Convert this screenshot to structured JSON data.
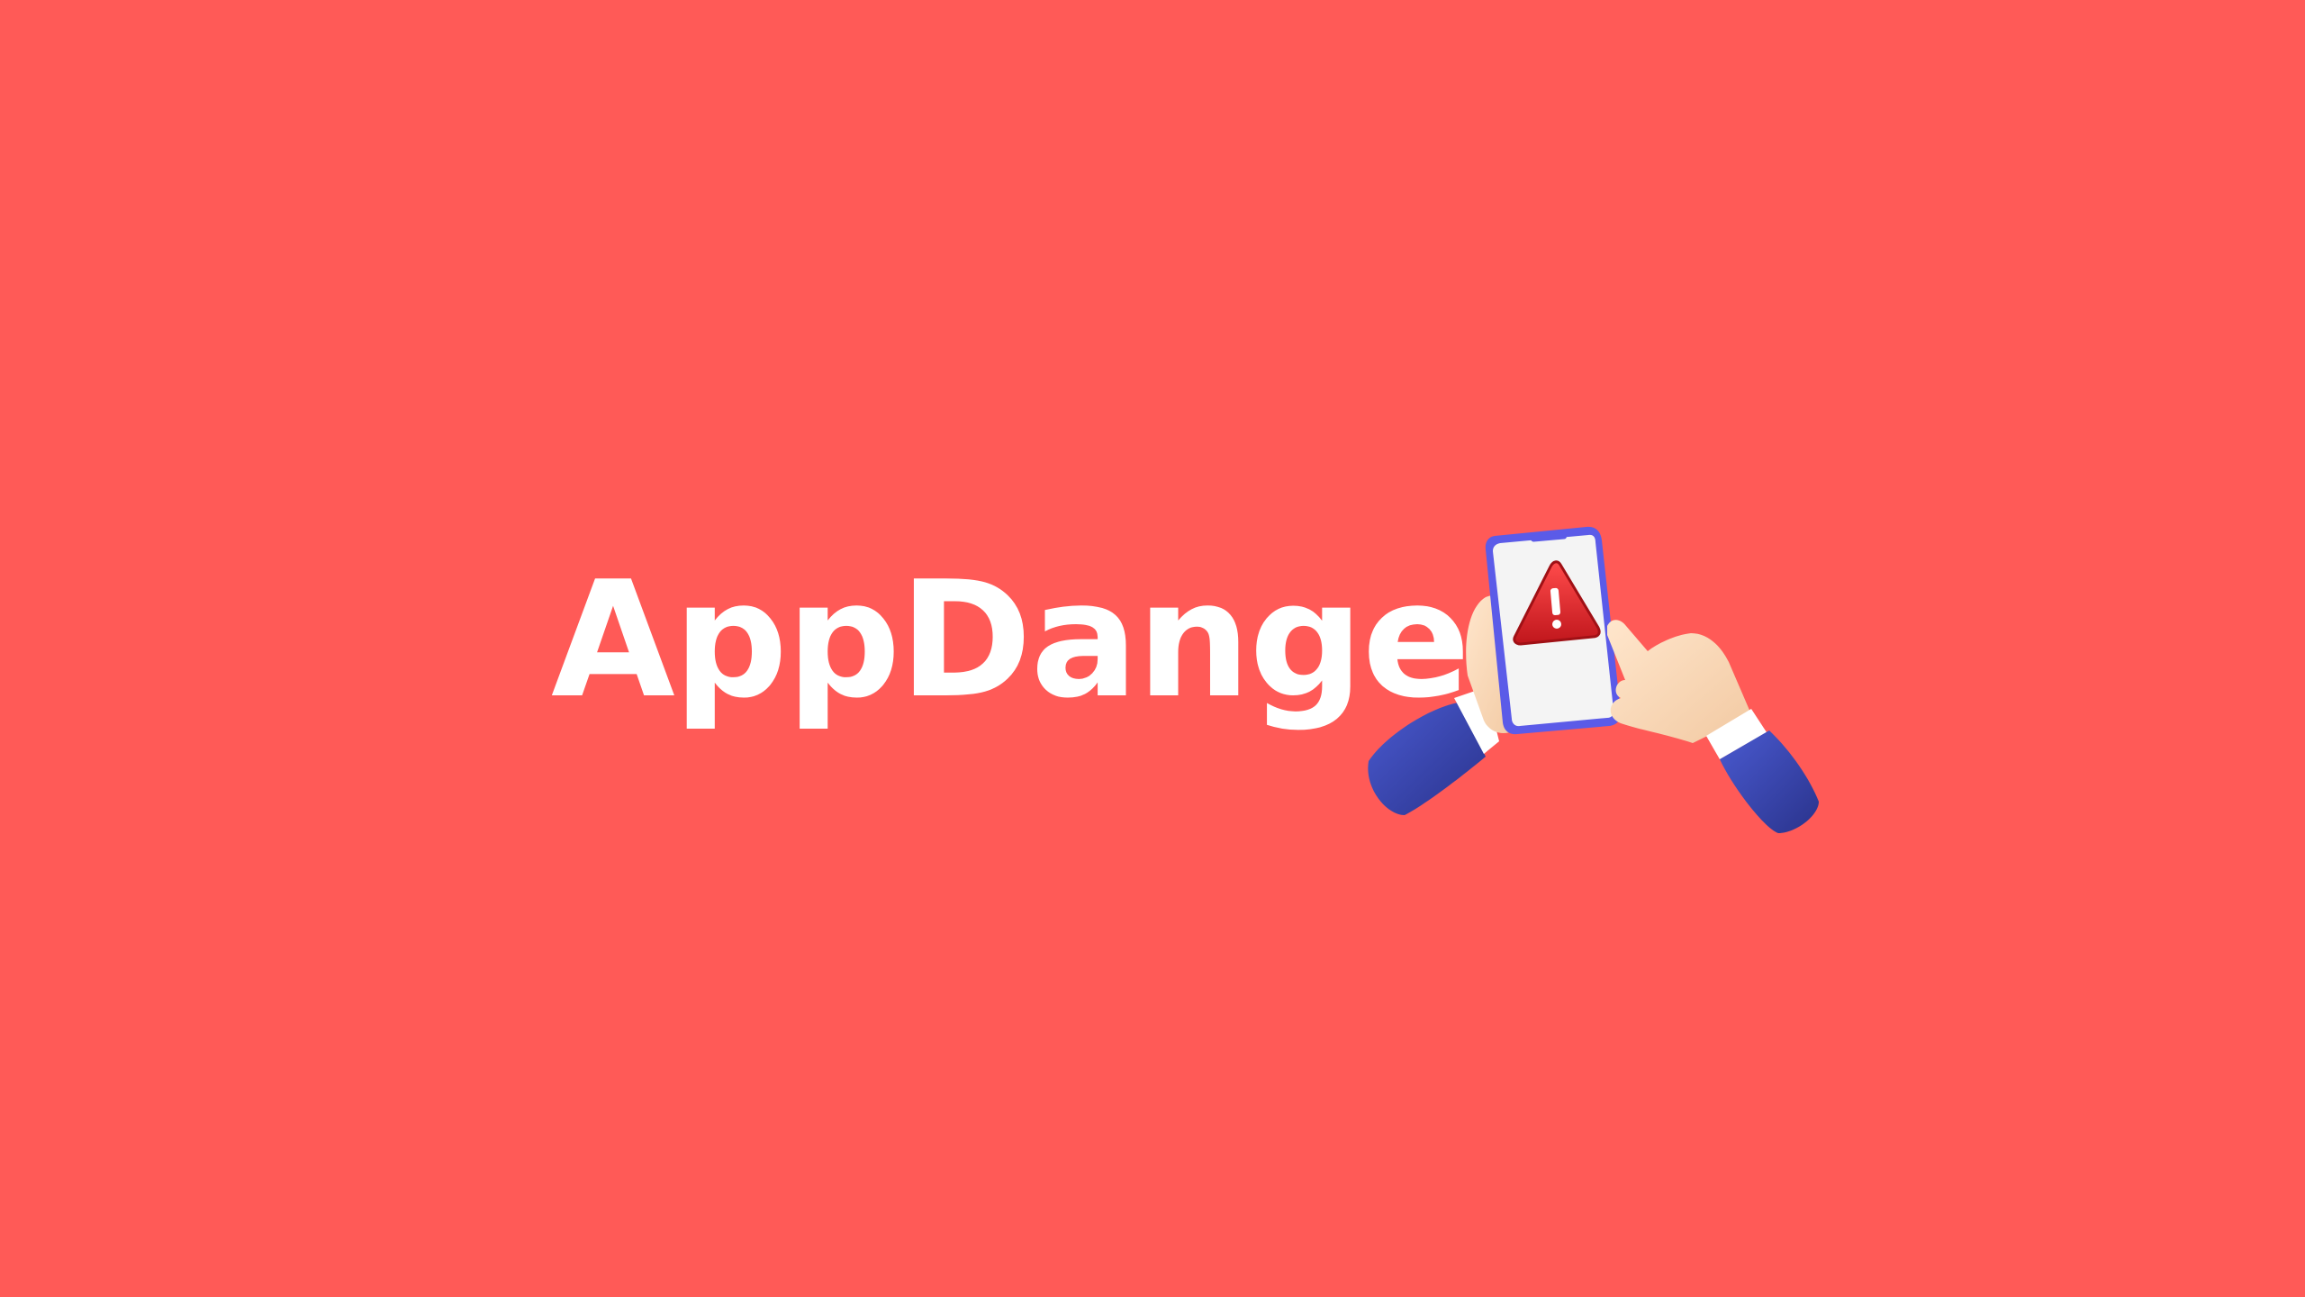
{
  "banner": {
    "title": "AppDanger",
    "background_color": "#FF5A57",
    "text_color": "#FFFFFF"
  },
  "illustration": {
    "icons": [
      "hand-holding-phone-icon",
      "smartphone-icon",
      "warning-triangle-icon",
      "pointing-hand-icon"
    ],
    "sleeve_color": "#3A47B0",
    "phone_frame_color": "#5B5BE8",
    "warning_color": "#E8242A"
  }
}
